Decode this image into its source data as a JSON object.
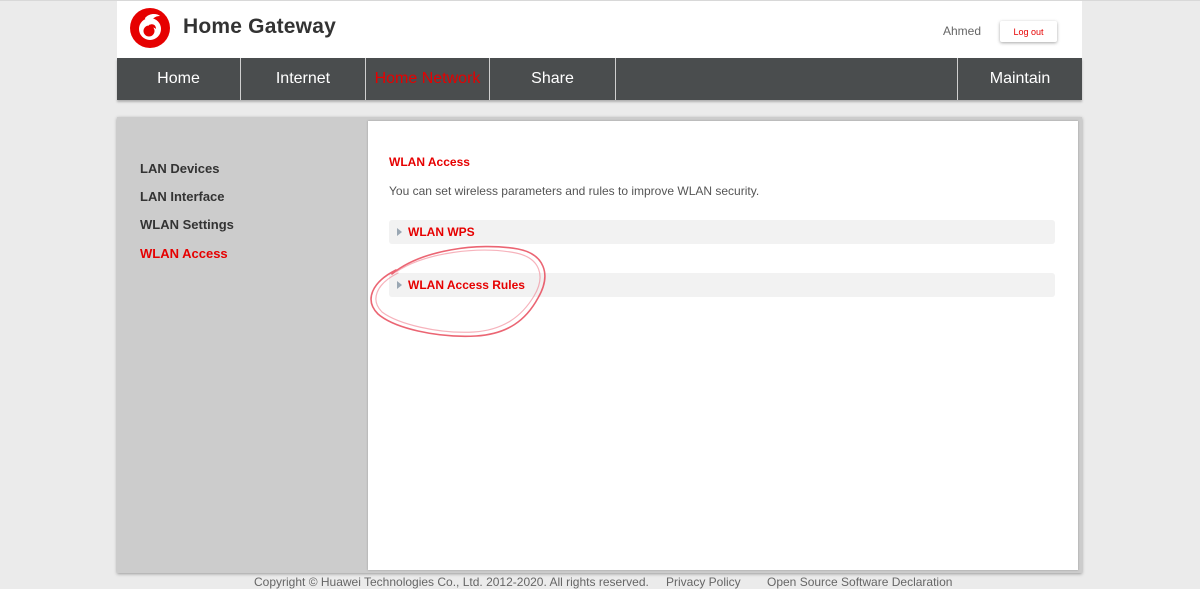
{
  "header": {
    "app_title": "Home Gateway",
    "username": "Ahmed",
    "logout_label": "Log out",
    "logo_icon": "vodafone-logo-icon",
    "brand_color": "#e60000"
  },
  "nav": {
    "items": [
      {
        "label": "Home",
        "active": false
      },
      {
        "label": "Internet",
        "active": false
      },
      {
        "label": "Home Network",
        "active": true
      },
      {
        "label": "Share",
        "active": false
      },
      {
        "label": "Maintain",
        "active": false
      }
    ]
  },
  "sidebar": {
    "items": [
      {
        "label": "LAN Devices",
        "active": false
      },
      {
        "label": "LAN Interface",
        "active": false
      },
      {
        "label": "WLAN Settings",
        "active": false
      },
      {
        "label": "WLAN Access",
        "active": true
      }
    ]
  },
  "main": {
    "title": "WLAN Access",
    "description": "You can set wireless parameters and rules to improve WLAN security.",
    "sections": [
      {
        "label": "WLAN WPS",
        "icon": "expand-arrow-icon"
      },
      {
        "label": "WLAN Access Rules",
        "icon": "expand-arrow-icon"
      }
    ]
  },
  "footer": {
    "copyright": "Copyright © Huawei Technologies Co., Ltd. 2012-2020. All rights reserved.",
    "privacy_link": "Privacy Policy",
    "open_source_link": "Open Source Software Declaration"
  }
}
